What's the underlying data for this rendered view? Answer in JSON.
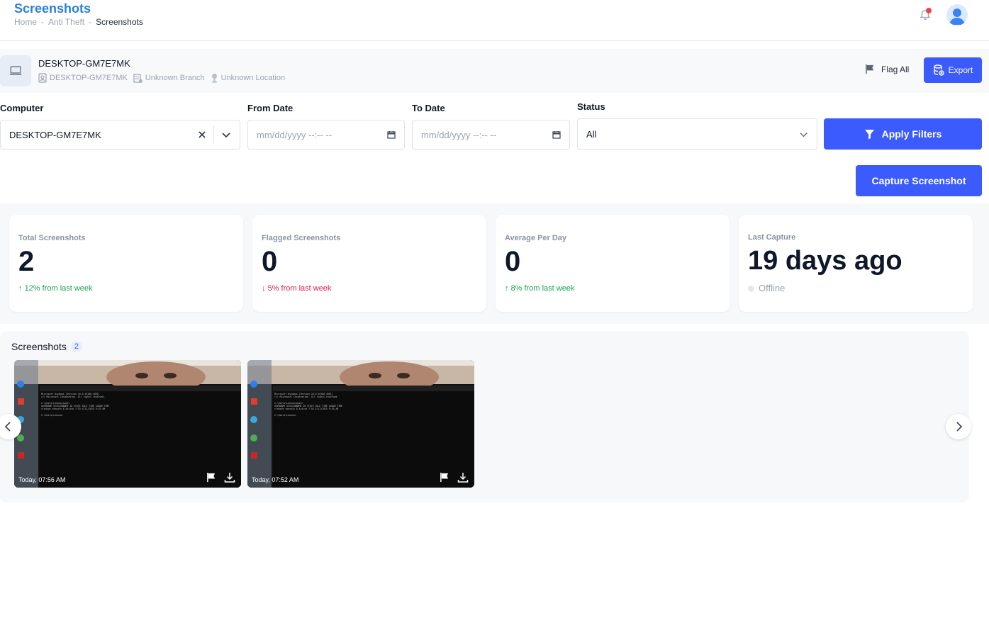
{
  "header": {
    "title": "Screenshots",
    "breadcrumb": [
      "Home",
      "Anti Theft",
      "Screenshots"
    ],
    "breadcrumb_sep": "-"
  },
  "device": {
    "name": "DESKTOP-GM7E7MK",
    "host": "DESKTOP-GM7E7MK",
    "branch": "Unknown Branch",
    "location": "Unknown Location",
    "flag_all_label": "Flag All",
    "export_label": "Export"
  },
  "filters": {
    "computer_label": "Computer",
    "computer_value": "DESKTOP-GM7E7MK",
    "from_label": "From Date",
    "from_placeholder": "mm/dd/yyyy --:-- --",
    "to_label": "To Date",
    "to_placeholder": "mm/dd/yyyy --:-- --",
    "status_label": "Status",
    "status_value": "All",
    "apply_label": "Apply Filters",
    "capture_label": "Capture Screenshot"
  },
  "stats": [
    {
      "label": "Total Screenshots",
      "value": "2",
      "trend": "12% from last week",
      "direction": "up"
    },
    {
      "label": "Flagged Screenshots",
      "value": "0",
      "trend": "5% from last week",
      "direction": "down"
    },
    {
      "label": "Average Per Day",
      "value": "0",
      "trend": "8% from last week",
      "direction": "up"
    },
    {
      "label": "Last Capture",
      "value": "19 days ago",
      "trend": "Offline",
      "direction": "status"
    }
  ],
  "screenshots": {
    "title": "Screenshots",
    "count": "2",
    "items": [
      {
        "time": "Today, 07:56 AM"
      },
      {
        "time": "Today, 07:52 AM"
      }
    ]
  },
  "colors": {
    "accent": "#3b5bfd",
    "title": "#2b7fd8",
    "up": "#16a34a",
    "down": "#e11d48"
  }
}
